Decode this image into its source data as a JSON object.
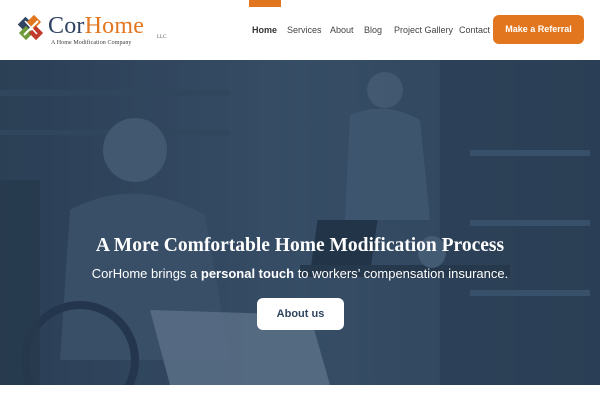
{
  "logo": {
    "brand_primary": "Cor",
    "brand_secondary": "Home",
    "suffix": "LLC",
    "tagline": "A Home Modification Company"
  },
  "nav": {
    "items": [
      {
        "label": "Home",
        "active": true
      },
      {
        "label": "Services",
        "active": false
      },
      {
        "label": "About",
        "active": false
      },
      {
        "label": "Blog",
        "active": false
      },
      {
        "label": "Project Gallery",
        "active": false
      },
      {
        "label": "Contact",
        "active": false
      }
    ],
    "cta_label": "Make a Referral"
  },
  "hero": {
    "title": "A More Comfortable Home Modification Process",
    "subtitle_pre": "CorHome brings a ",
    "subtitle_bold": "personal touch",
    "subtitle_post": " to workers’ compensation insurance.",
    "button_label": "About us"
  },
  "colors": {
    "accent": "#e2761f",
    "navy": "#2f4460",
    "hero_overlay": "#2c4056"
  }
}
